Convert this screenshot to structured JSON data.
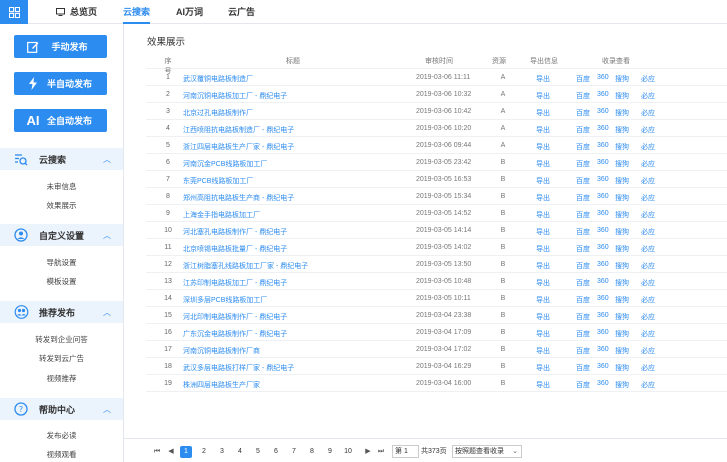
{
  "nav": {
    "tabs": [
      {
        "label": "总览页"
      },
      {
        "label": "云搜索"
      },
      {
        "label": "AI万词"
      },
      {
        "label": "云广告"
      }
    ]
  },
  "sidebar": {
    "buttons": [
      {
        "label": "手动发布"
      },
      {
        "label": "半自动发布"
      },
      {
        "label": "全自动发布",
        "icon_text": "AI"
      }
    ],
    "sections": [
      {
        "label": "云搜索",
        "items": [
          "未审信息",
          "效果展示"
        ]
      },
      {
        "label": "自定义设置",
        "items": [
          "导航设置",
          "模板设置"
        ]
      },
      {
        "label": "推荐发布",
        "items": [
          "转发到企业问答",
          "转发到云广告",
          "视频推荐"
        ]
      },
      {
        "label": "帮助中心",
        "items": [
          "发布必读",
          "视频观看"
        ]
      }
    ]
  },
  "main": {
    "title": "效果展示",
    "headers": {
      "idx": "序号",
      "title": "标题",
      "time": "审核时间",
      "source": "资源",
      "export": "导出信息",
      "check": "收录查看"
    },
    "link_labels": {
      "export": "导出",
      "baidu": "百度",
      "s360": "360",
      "sogou": "搜狗",
      "biying": "必应"
    },
    "rows": [
      {
        "idx": "1",
        "title": "武汉覆铜电路板制造厂",
        "time": "2019-03-06 11:11",
        "source": "A"
      },
      {
        "idx": "2",
        "title": "河南沉铜电路板加工厂 - 鼎纪电子",
        "time": "2019-03-06 10:32",
        "source": "A"
      },
      {
        "idx": "3",
        "title": "北京过孔电路板制作厂",
        "time": "2019-03-06 10:42",
        "source": "A"
      },
      {
        "idx": "4",
        "title": "江西喷阻抗电路板制造厂 - 鼎纪电子",
        "time": "2019-03-06 10:20",
        "source": "A"
      },
      {
        "idx": "5",
        "title": "浙江四层电路板生产厂家 - 鼎纪电子",
        "time": "2019-03-06 09:44",
        "source": "A"
      },
      {
        "idx": "6",
        "title": "河南沉金PCB线路板加工厂",
        "time": "2019-03-05 23:42",
        "source": "B"
      },
      {
        "idx": "7",
        "title": "东莞PCB线路板加工厂",
        "time": "2019-03-05 16:53",
        "source": "B"
      },
      {
        "idx": "8",
        "title": "郑州高阻抗电路板生产商 - 鼎纪电子",
        "time": "2019-03-05 15:34",
        "source": "B"
      },
      {
        "idx": "9",
        "title": "上海金手指电路板加工厂",
        "time": "2019-03-05 14:52",
        "source": "B"
      },
      {
        "idx": "10",
        "title": "河北塞孔电路板制作厂 - 鼎纪电子",
        "time": "2019-03-05 14:14",
        "source": "B"
      },
      {
        "idx": "11",
        "title": "北京喷锡电路板批量厂 - 鼎纪电子",
        "time": "2019-03-05 14:02",
        "source": "B"
      },
      {
        "idx": "12",
        "title": "浙江树脂塞孔线路板加工厂家 - 鼎纪电子",
        "time": "2019-03-05 13:50",
        "source": "B"
      },
      {
        "idx": "13",
        "title": "江苏印制电路板加工厂 - 鼎纪电子",
        "time": "2019-03-05 10:48",
        "source": "B"
      },
      {
        "idx": "14",
        "title": "深圳多层PCB线路板加工厂",
        "time": "2019-03-05 10:11",
        "source": "B"
      },
      {
        "idx": "15",
        "title": "河北印制电路板制作厂 - 鼎纪电子",
        "time": "2019-03-04 23:38",
        "source": "B"
      },
      {
        "idx": "16",
        "title": "广东沉金电路板制作厂 - 鼎纪电子",
        "time": "2019-03-04 17:09",
        "source": "B"
      },
      {
        "idx": "17",
        "title": "河南沉铜电路板制作厂商",
        "time": "2019-03-04 17:02",
        "source": "B"
      },
      {
        "idx": "18",
        "title": "武汉多层电路板打样厂家 - 鼎纪电子",
        "time": "2019-03-04 16:29",
        "source": "B"
      },
      {
        "idx": "19",
        "title": "株洲四层电路板生产厂家",
        "time": "2019-03-04 16:00",
        "source": "B"
      }
    ]
  },
  "pager": {
    "pages": [
      "1",
      "2",
      "3",
      "4",
      "5",
      "6",
      "7",
      "8",
      "9",
      "10"
    ],
    "current": "1",
    "goto_value": "第 1",
    "total": "共373页",
    "sort_label": "按照题查看收录"
  },
  "colors": {
    "accent": "#2d8cf0",
    "section_bg": "#ebf3fc"
  }
}
